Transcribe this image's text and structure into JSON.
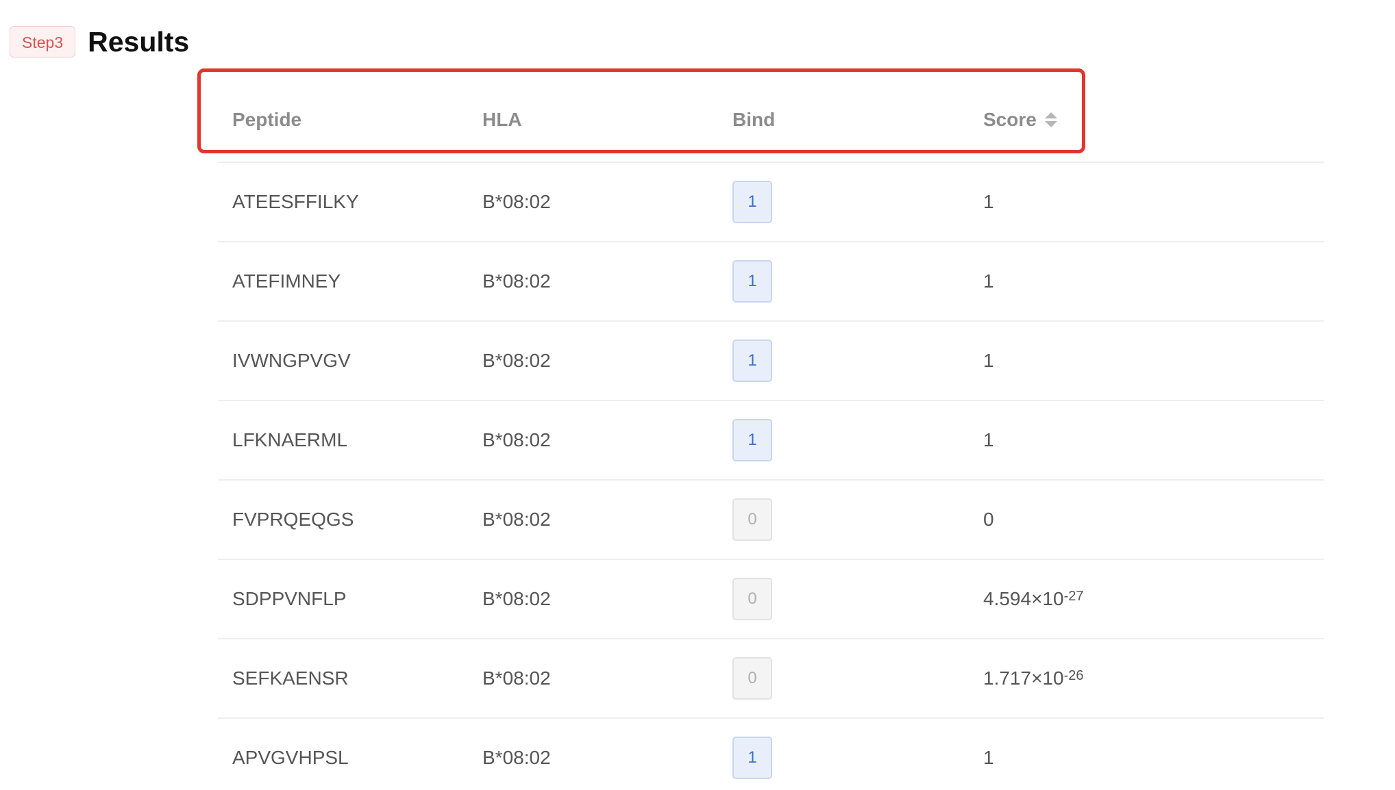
{
  "header": {
    "step_label": "Step3",
    "title": "Results"
  },
  "table": {
    "columns": {
      "peptide": "Peptide",
      "hla": "HLA",
      "bind": "Bind",
      "score": "Score"
    },
    "rows": [
      {
        "peptide": "ATEESFFILKY",
        "hla": "B*08:02",
        "bind": "1",
        "score_base": "1",
        "score_exp": ""
      },
      {
        "peptide": "ATEFIMNEY",
        "hla": "B*08:02",
        "bind": "1",
        "score_base": "1",
        "score_exp": ""
      },
      {
        "peptide": "IVWNGPVGV",
        "hla": "B*08:02",
        "bind": "1",
        "score_base": "1",
        "score_exp": ""
      },
      {
        "peptide": "LFKNAERML",
        "hla": "B*08:02",
        "bind": "1",
        "score_base": "1",
        "score_exp": ""
      },
      {
        "peptide": "FVPRQEQGS",
        "hla": "B*08:02",
        "bind": "0",
        "score_base": "0",
        "score_exp": ""
      },
      {
        "peptide": "SDPPVNFLP",
        "hla": "B*08:02",
        "bind": "0",
        "score_base": "4.594×10",
        "score_exp": "-27"
      },
      {
        "peptide": "SEFKAENSR",
        "hla": "B*08:02",
        "bind": "0",
        "score_base": "1.717×10",
        "score_exp": "-26"
      },
      {
        "peptide": "APVGVHPSL",
        "hla": "B*08:02",
        "bind": "1",
        "score_base": "1",
        "score_exp": ""
      }
    ]
  },
  "colors": {
    "highlight": "#e0362c",
    "step_badge_text": "#d9534f",
    "bind_positive": "#3b6fc7",
    "bind_negative": "#b0b0b0"
  },
  "icons": {
    "sort": "sort-icon"
  }
}
